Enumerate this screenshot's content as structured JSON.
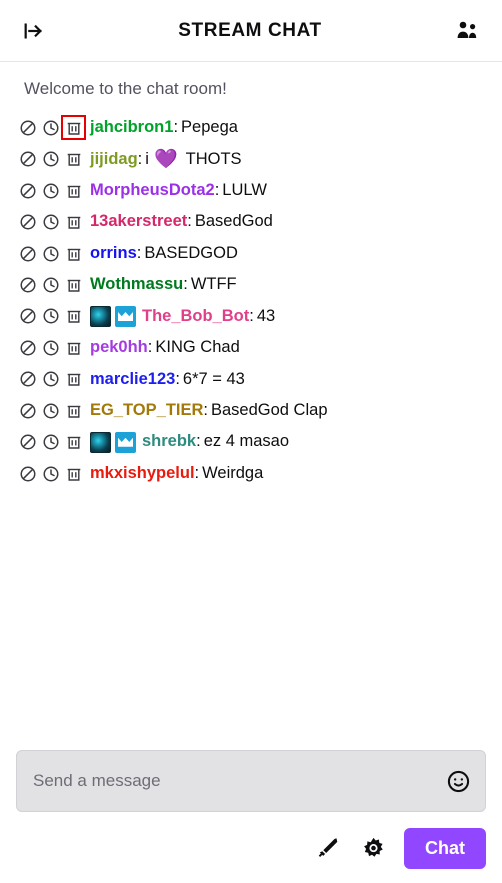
{
  "header": {
    "title": "STREAM CHAT",
    "collapse_icon": "collapse-right-arrow-icon",
    "community_icon": "community-users-icon"
  },
  "chat": {
    "welcome": "Welcome to the chat room!",
    "mod_actions": {
      "ban_label": "ban-icon",
      "timeout_label": "timeout-clock-icon",
      "delete_label": "delete-trash-icon"
    },
    "messages": [
      {
        "username": "jahcibron1",
        "color": "#00a32a",
        "separator": ":",
        "text": "Pepega",
        "badges": [],
        "delete_highlighted": true
      },
      {
        "username": "jijidag",
        "color": "#7d9b1f",
        "separator": ":",
        "text": "i",
        "emote": "💜",
        "text_after": "THOTS",
        "badges": [],
        "delete_highlighted": false
      },
      {
        "username": "MorpheusDota2",
        "color": "#9b30e8",
        "separator": ":",
        "text": "LULW",
        "badges": [],
        "delete_highlighted": false
      },
      {
        "username": "13akerstreet",
        "color": "#d4286b",
        "separator": ":",
        "text": "BasedGod",
        "badges": [],
        "delete_highlighted": false
      },
      {
        "username": "orrins",
        "color": "#1414f0",
        "separator": ":",
        "text": "BASEDGOD",
        "badges": [],
        "delete_highlighted": false
      },
      {
        "username": "Wothmassu",
        "color": "#007a1f",
        "separator": ":",
        "text": "WTFF",
        "badges": [],
        "delete_highlighted": false
      },
      {
        "username": "The_Bob_Bot",
        "color": "#e0408a",
        "separator": ":",
        "text": "43",
        "badges": [
          "subscriber-badge",
          "vip-crown-badge"
        ],
        "delete_highlighted": false
      },
      {
        "username": "pek0hh",
        "color": "#a43ce0",
        "separator": ":",
        "text": "KING Chad",
        "badges": [],
        "delete_highlighted": false
      },
      {
        "username": "marclie123",
        "color": "#1e1ef0",
        "separator": ":",
        "text": "6*7 = 43",
        "badges": [],
        "delete_highlighted": false
      },
      {
        "username": "EG_TOP_TIER",
        "color": "#a37a0a",
        "separator": ":",
        "text": "BasedGod Clap",
        "badges": [],
        "delete_highlighted": false
      },
      {
        "username": "shrebk",
        "color": "#2e8b7f",
        "separator": ":",
        "text": "ez 4 masao",
        "badges": [
          "subscriber-badge",
          "vip-crown-badge"
        ],
        "delete_highlighted": false
      },
      {
        "username": "mkxishypelul",
        "color": "#e81b0e",
        "separator": ":",
        "text": "Weirdga",
        "badges": [],
        "delete_highlighted": false
      }
    ]
  },
  "footer": {
    "input_placeholder": "Send a message",
    "input_value": "",
    "emoji_icon": "emoji-smiley-icon",
    "mod_sword_icon": "sword-mod-icon",
    "settings_icon": "gear-settings-icon",
    "send_label": "Chat",
    "accent_color": "#9147ff"
  }
}
